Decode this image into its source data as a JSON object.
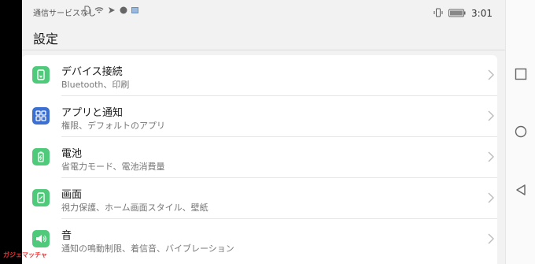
{
  "status_bar": {
    "carrier": "通信サービスなし",
    "time": "3:01"
  },
  "page": {
    "title": "設定"
  },
  "settings_items": [
    {
      "title": "デバイス接続",
      "subtitle": "Bluetooth、印刷",
      "icon": "device-connection-icon"
    },
    {
      "title": "アプリと通知",
      "subtitle": "権限、デフォルトのアプリ",
      "icon": "apps-icon"
    },
    {
      "title": "電池",
      "subtitle": "省電力モード、電池消費量",
      "icon": "battery-icon"
    },
    {
      "title": "画面",
      "subtitle": "視力保護、ホーム画面スタイル、壁紙",
      "icon": "display-icon"
    },
    {
      "title": "音",
      "subtitle": "通知の鳴動制限、着信音、バイブレーション",
      "icon": "sound-icon"
    }
  ],
  "watermark": "ガジェマッチャ",
  "colors": {
    "icon_green": "#4fc97a",
    "icon_blue": "#3b6fd1"
  }
}
